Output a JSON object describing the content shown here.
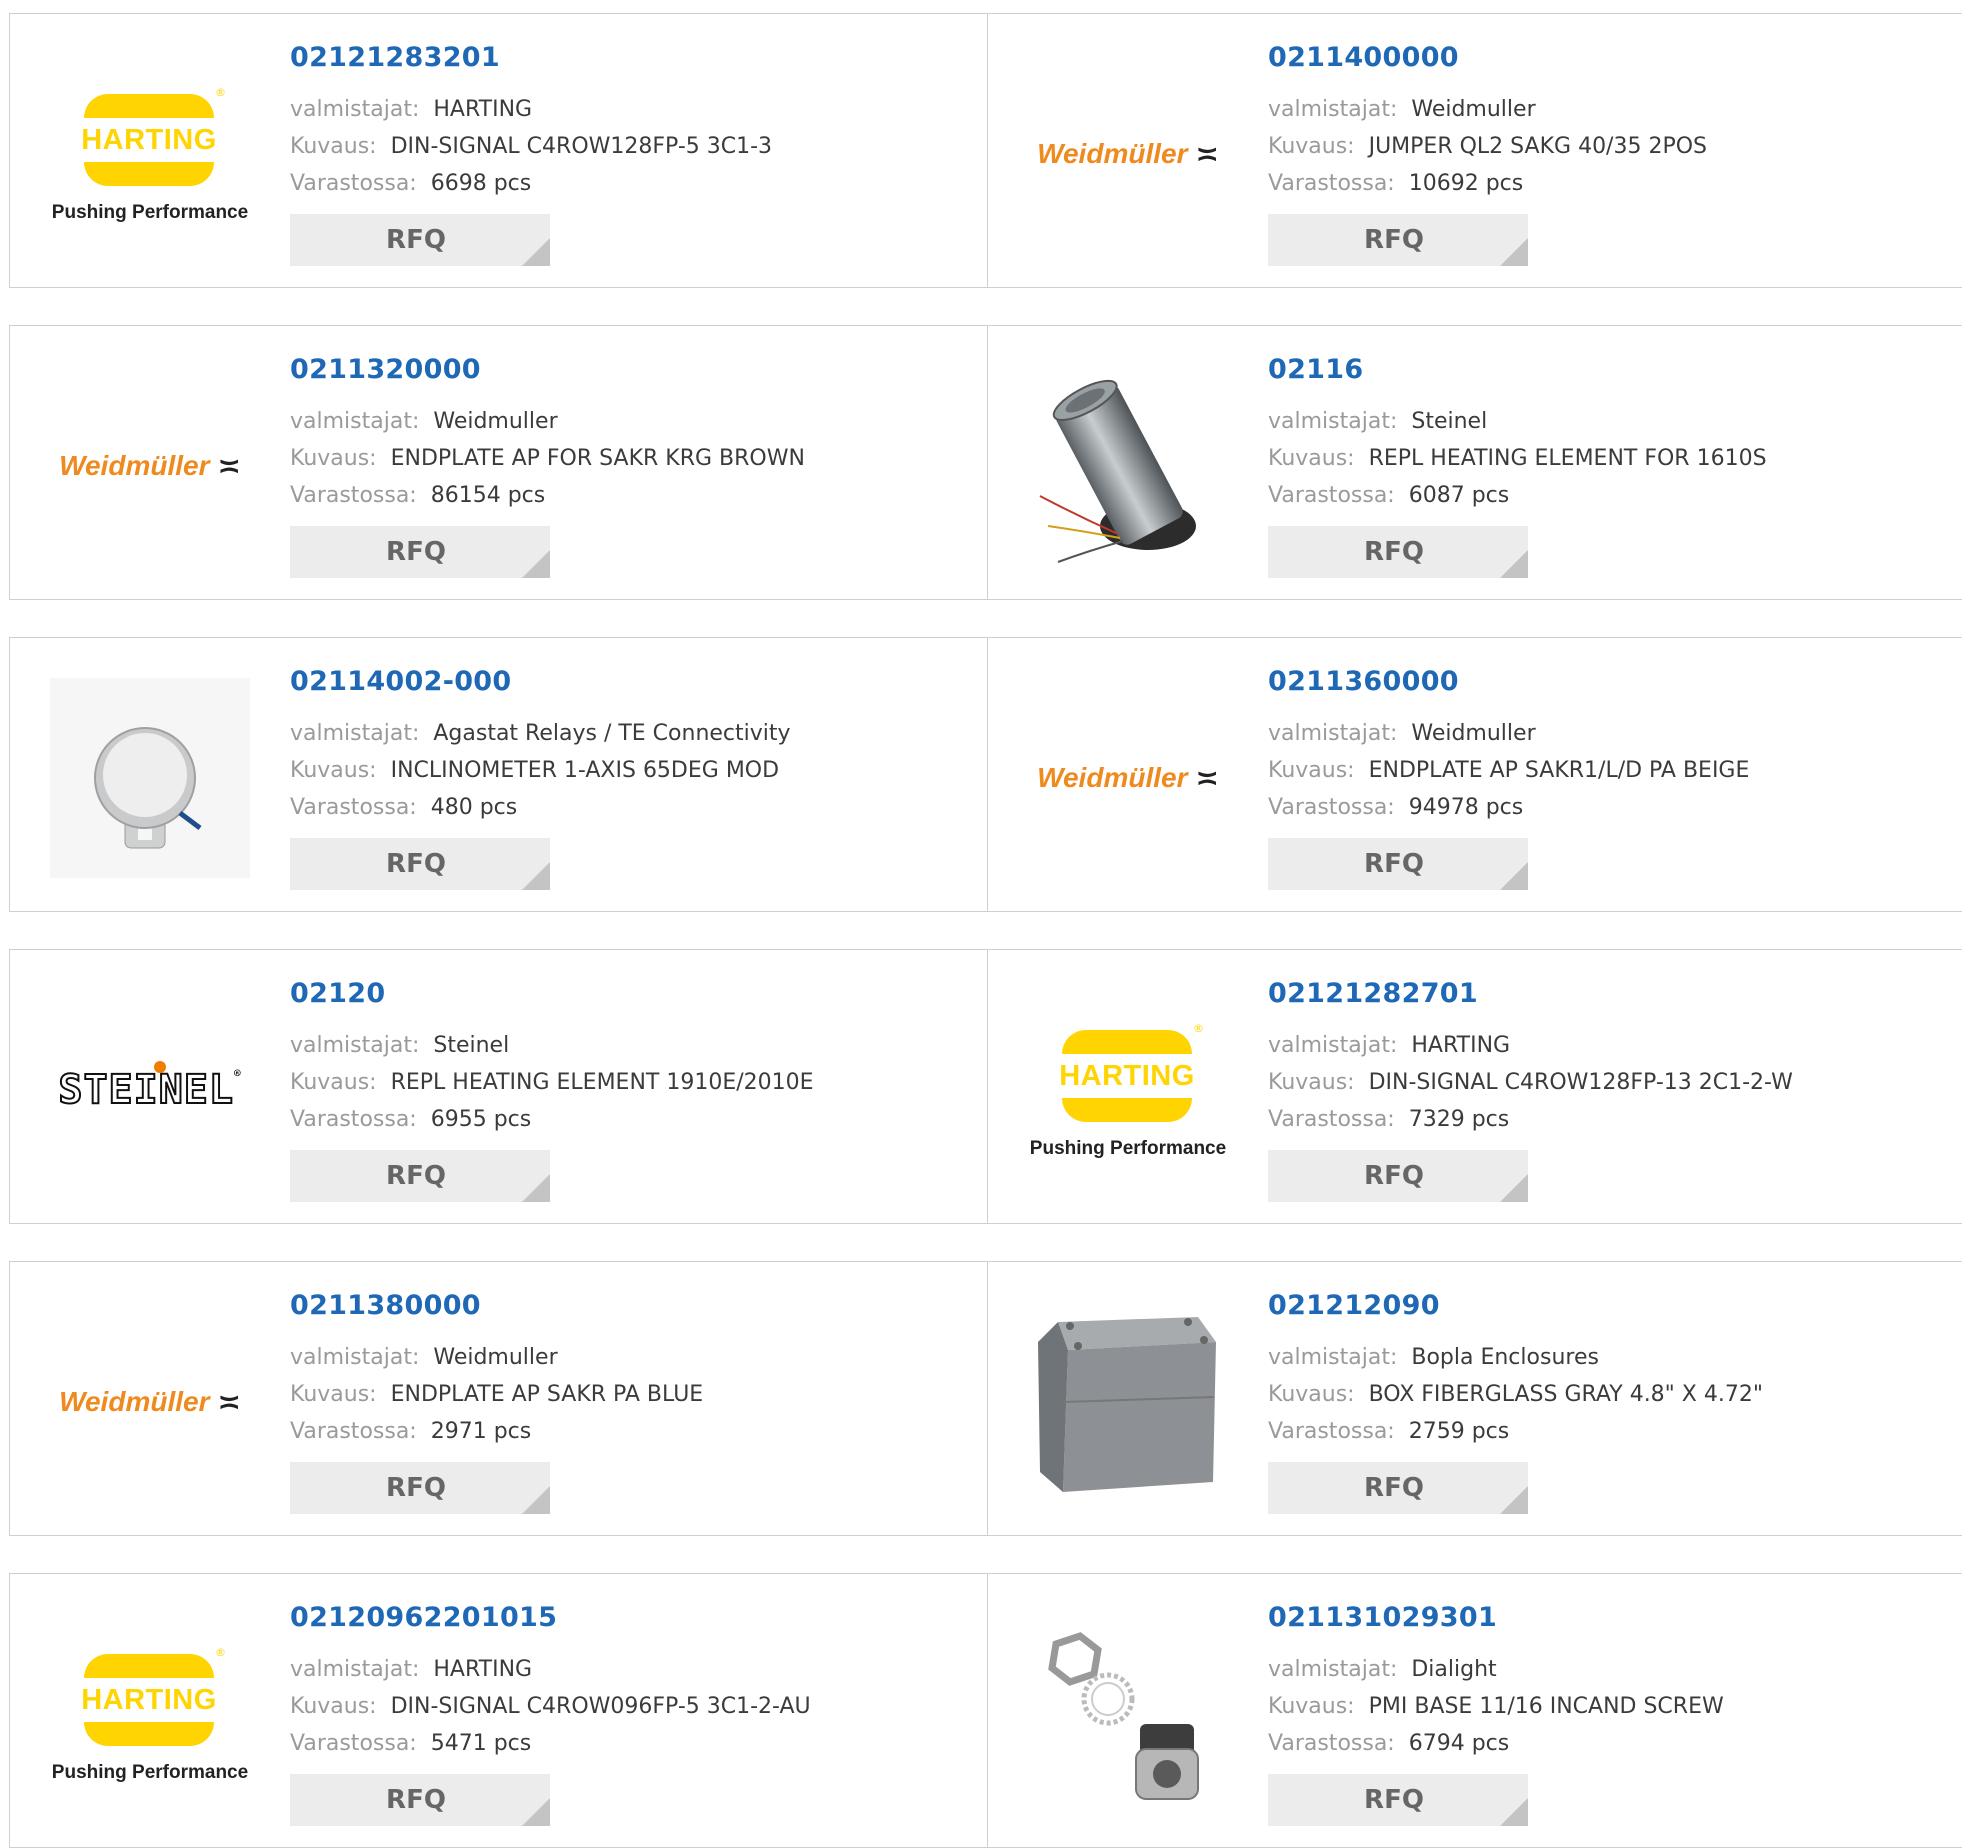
{
  "labels": {
    "manufacturer": "valmistajat:",
    "description": "Kuvaus:",
    "stock": "Varastossa:",
    "rfq": "RFQ"
  },
  "products": [
    {
      "part": "02121283201",
      "manufacturer": "HARTING",
      "description": "DIN-SIGNAL C4ROW128FP-5 3C1-3",
      "stock": "6698 pcs",
      "image": "harting-logo",
      "logo_tagline": "Pushing Performance"
    },
    {
      "part": "0211400000",
      "manufacturer": "Weidmuller",
      "description": "JUMPER QL2 SAKG 40/35 2POS",
      "stock": "10692 pcs",
      "image": "weidmuller-logo",
      "logo_text": "Weidmüller"
    },
    {
      "part": "0211320000",
      "manufacturer": "Weidmuller",
      "description": "ENDPLATE AP FOR SAKR KRG BROWN",
      "stock": "86154 pcs",
      "image": "weidmuller-logo",
      "logo_text": "Weidmüller"
    },
    {
      "part": "02116",
      "manufacturer": "Steinel",
      "description": "REPL HEATING ELEMENT FOR 1610S",
      "stock": "6087 pcs",
      "image": "heating-element-photo"
    },
    {
      "part": "02114002-000",
      "manufacturer": "Agastat Relays / TE Connectivity",
      "description": "INCLINOMETER 1-AXIS 65DEG MOD",
      "stock": "480 pcs",
      "image": "inclinometer-photo"
    },
    {
      "part": "0211360000",
      "manufacturer": "Weidmuller",
      "description": "ENDPLATE AP SAKR1/L/D PA BEIGE",
      "stock": "94978 pcs",
      "image": "weidmuller-logo",
      "logo_text": "Weidmüller"
    },
    {
      "part": "02120",
      "manufacturer": "Steinel",
      "description": "REPL HEATING ELEMENT 1910E/2010E",
      "stock": "6955 pcs",
      "image": "steinel-logo",
      "logo_text": "STEINEL"
    },
    {
      "part": "02121282701",
      "manufacturer": "HARTING",
      "description": "DIN-SIGNAL C4ROW128FP-13 2C1-2-W",
      "stock": "7329 pcs",
      "image": "harting-logo",
      "logo_tagline": "Pushing Performance"
    },
    {
      "part": "0211380000",
      "manufacturer": "Weidmuller",
      "description": "ENDPLATE AP SAKR PA BLUE",
      "stock": "2971 pcs",
      "image": "weidmuller-logo",
      "logo_text": "Weidmüller"
    },
    {
      "part": "021212090",
      "manufacturer": "Bopla Enclosures",
      "description": "BOX FIBERGLASS GRAY 4.8\" X 4.72\"",
      "stock": "2759 pcs",
      "image": "enclosure-box-photo"
    },
    {
      "part": "02120962201015",
      "manufacturer": "HARTING",
      "description": "DIN-SIGNAL C4ROW096FP-5 3C1-2-AU",
      "stock": "5471 pcs",
      "image": "harting-logo",
      "logo_tagline": "Pushing Performance"
    },
    {
      "part": "021131029301",
      "manufacturer": "Dialight",
      "description": "PMI BASE 11/16 INCAND SCREW",
      "stock": "6794 pcs",
      "image": "lamp-base-photo"
    }
  ]
}
